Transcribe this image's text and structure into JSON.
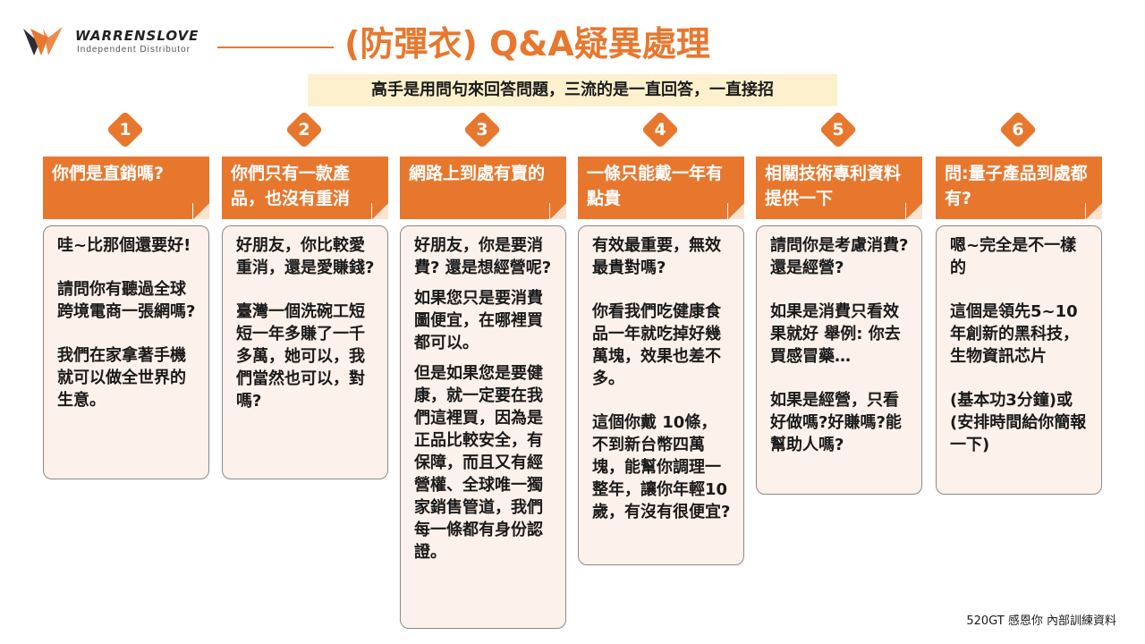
{
  "logo": {
    "brand": "WARRENSLOVE",
    "subtitle": "Independent  Distributor"
  },
  "title": "(防彈衣) Q&A疑異處理",
  "subtitle": "高手是用問句來回答問題，三流的是一直回答，一直接招",
  "columns": [
    {
      "number": "1",
      "question": "你們是直銷嗎?",
      "answers": [
        "哇~比那個還要好!",
        "請問你有聽過全球跨境電商一張網嗎?",
        "我們在家拿著手機就可以做全世界的生意。"
      ]
    },
    {
      "number": "2",
      "question": "你們只有一款產品，也沒有重消",
      "answers": [
        "好朋友，你比較愛重消，還是愛賺錢?",
        "臺灣一個洗碗工短短一年多賺了一千多萬，她可以，我們當然也可以，對嗎?"
      ]
    },
    {
      "number": "3",
      "question": "網路上到處有賣的",
      "answers": [
        "好朋友，你是要消費?  還是想經營呢?",
        "如果您只是要消費圖便宜，在哪裡買都可以。",
        "但是如果您是要健康，就一定要在我們這裡買，因為是正品比較安全，有保障，而且又有經營權、全球唯一獨家銷售管道，我們每一條都有身份認證。"
      ]
    },
    {
      "number": "4",
      "question": "一條只能戴一年有點貴",
      "answers": [
        "有效最重要，無效最貴對嗎?",
        "你看我們吃健康食品一年就吃掉好幾萬塊，效果也差不多。",
        "這個你戴 10條，不到新台幣四萬塊，能幫你調理一整年，讓你年輕10歲，有沒有很便宜?"
      ]
    },
    {
      "number": "5",
      "question": "相關技術專利資料提供一下",
      "answers": [
        "請問你是考慮消費?  還是經營?",
        "如果是消費只看效果就好    舉例: 你去買感冒藥…",
        "如果是經營，只看好做嗎?好賺嗎?能幫助人嗎?"
      ]
    },
    {
      "number": "6",
      "question": "問:量子產品到處都有?",
      "answers": [
        "嗯~完全是不一樣的",
        "這個是領先5~10年創新的黑科技，生物資訊芯片",
        "(基本功3分鐘)或(安排時間給你簡報一下)"
      ]
    }
  ],
  "footer": "520GT 感恩你  內部訓練資料",
  "colors": {
    "accent": "#e8772e",
    "subtitle_bg": "#fdf1cd",
    "answer_bg": "#fdf1eb"
  }
}
